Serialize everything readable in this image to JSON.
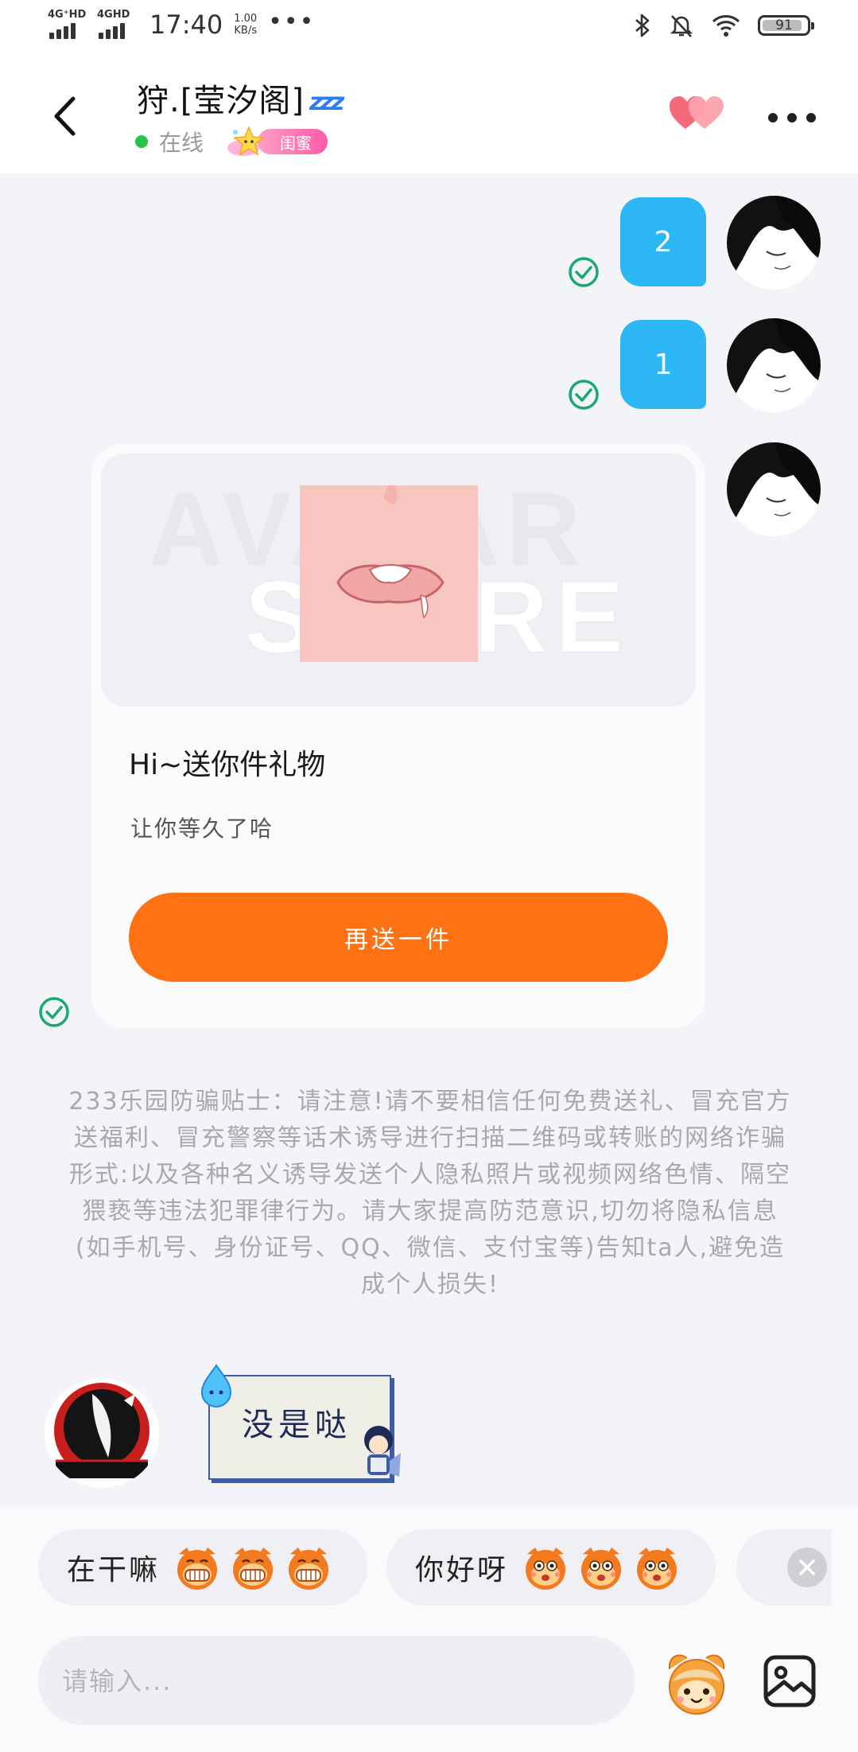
{
  "status_bar": {
    "signal1": "4G⁺HD",
    "signal2": "4GHD",
    "time": "17:40",
    "net_speed": "1.00",
    "net_unit": "KB/s",
    "dots": "•••",
    "battery": "91"
  },
  "header": {
    "title": "狩.[莹汐阁]",
    "zzz": "zzz",
    "online": "在线",
    "badge": "闺蜜"
  },
  "messages": [
    {
      "text": "2"
    },
    {
      "text": "1"
    }
  ],
  "gift_card": {
    "watermark_l1": "AVATAR",
    "watermark_l2": "STORE",
    "title": "Hi~送你件礼物",
    "subtitle": "让你等久了哈",
    "button": "再送一件"
  },
  "tips": "233乐园防骗贴士：请注意!请不要相信任何免费送礼、冒充官方送福利、冒充警察等话术诱导进行扫描二维码或转账的网络诈骗形式:以及各种名义诱导发送个人隐私照片或视频网络色情、隔空猥亵等违法犯罪律行为。请大家提高防范意识,切勿将隐私信息(如手机号、身份证号、QQ、微信、支付宝等)告知ta人,避免造成个人损失!",
  "sticker": {
    "text": "没是哒"
  },
  "quick_replies": [
    {
      "label": "在干嘛"
    },
    {
      "label": "你好呀"
    }
  ],
  "input": {
    "placeholder": "请输入..."
  },
  "colors": {
    "accent_blue": "#2db7f5",
    "send_orange": "#ff7213",
    "online_green": "#27c24c",
    "check_green": "#1aa872"
  },
  "icons": [
    "back-arrow-icon",
    "hearts-icon",
    "more-icon",
    "check-icon",
    "close-icon",
    "emoji-icon",
    "image-icon"
  ]
}
